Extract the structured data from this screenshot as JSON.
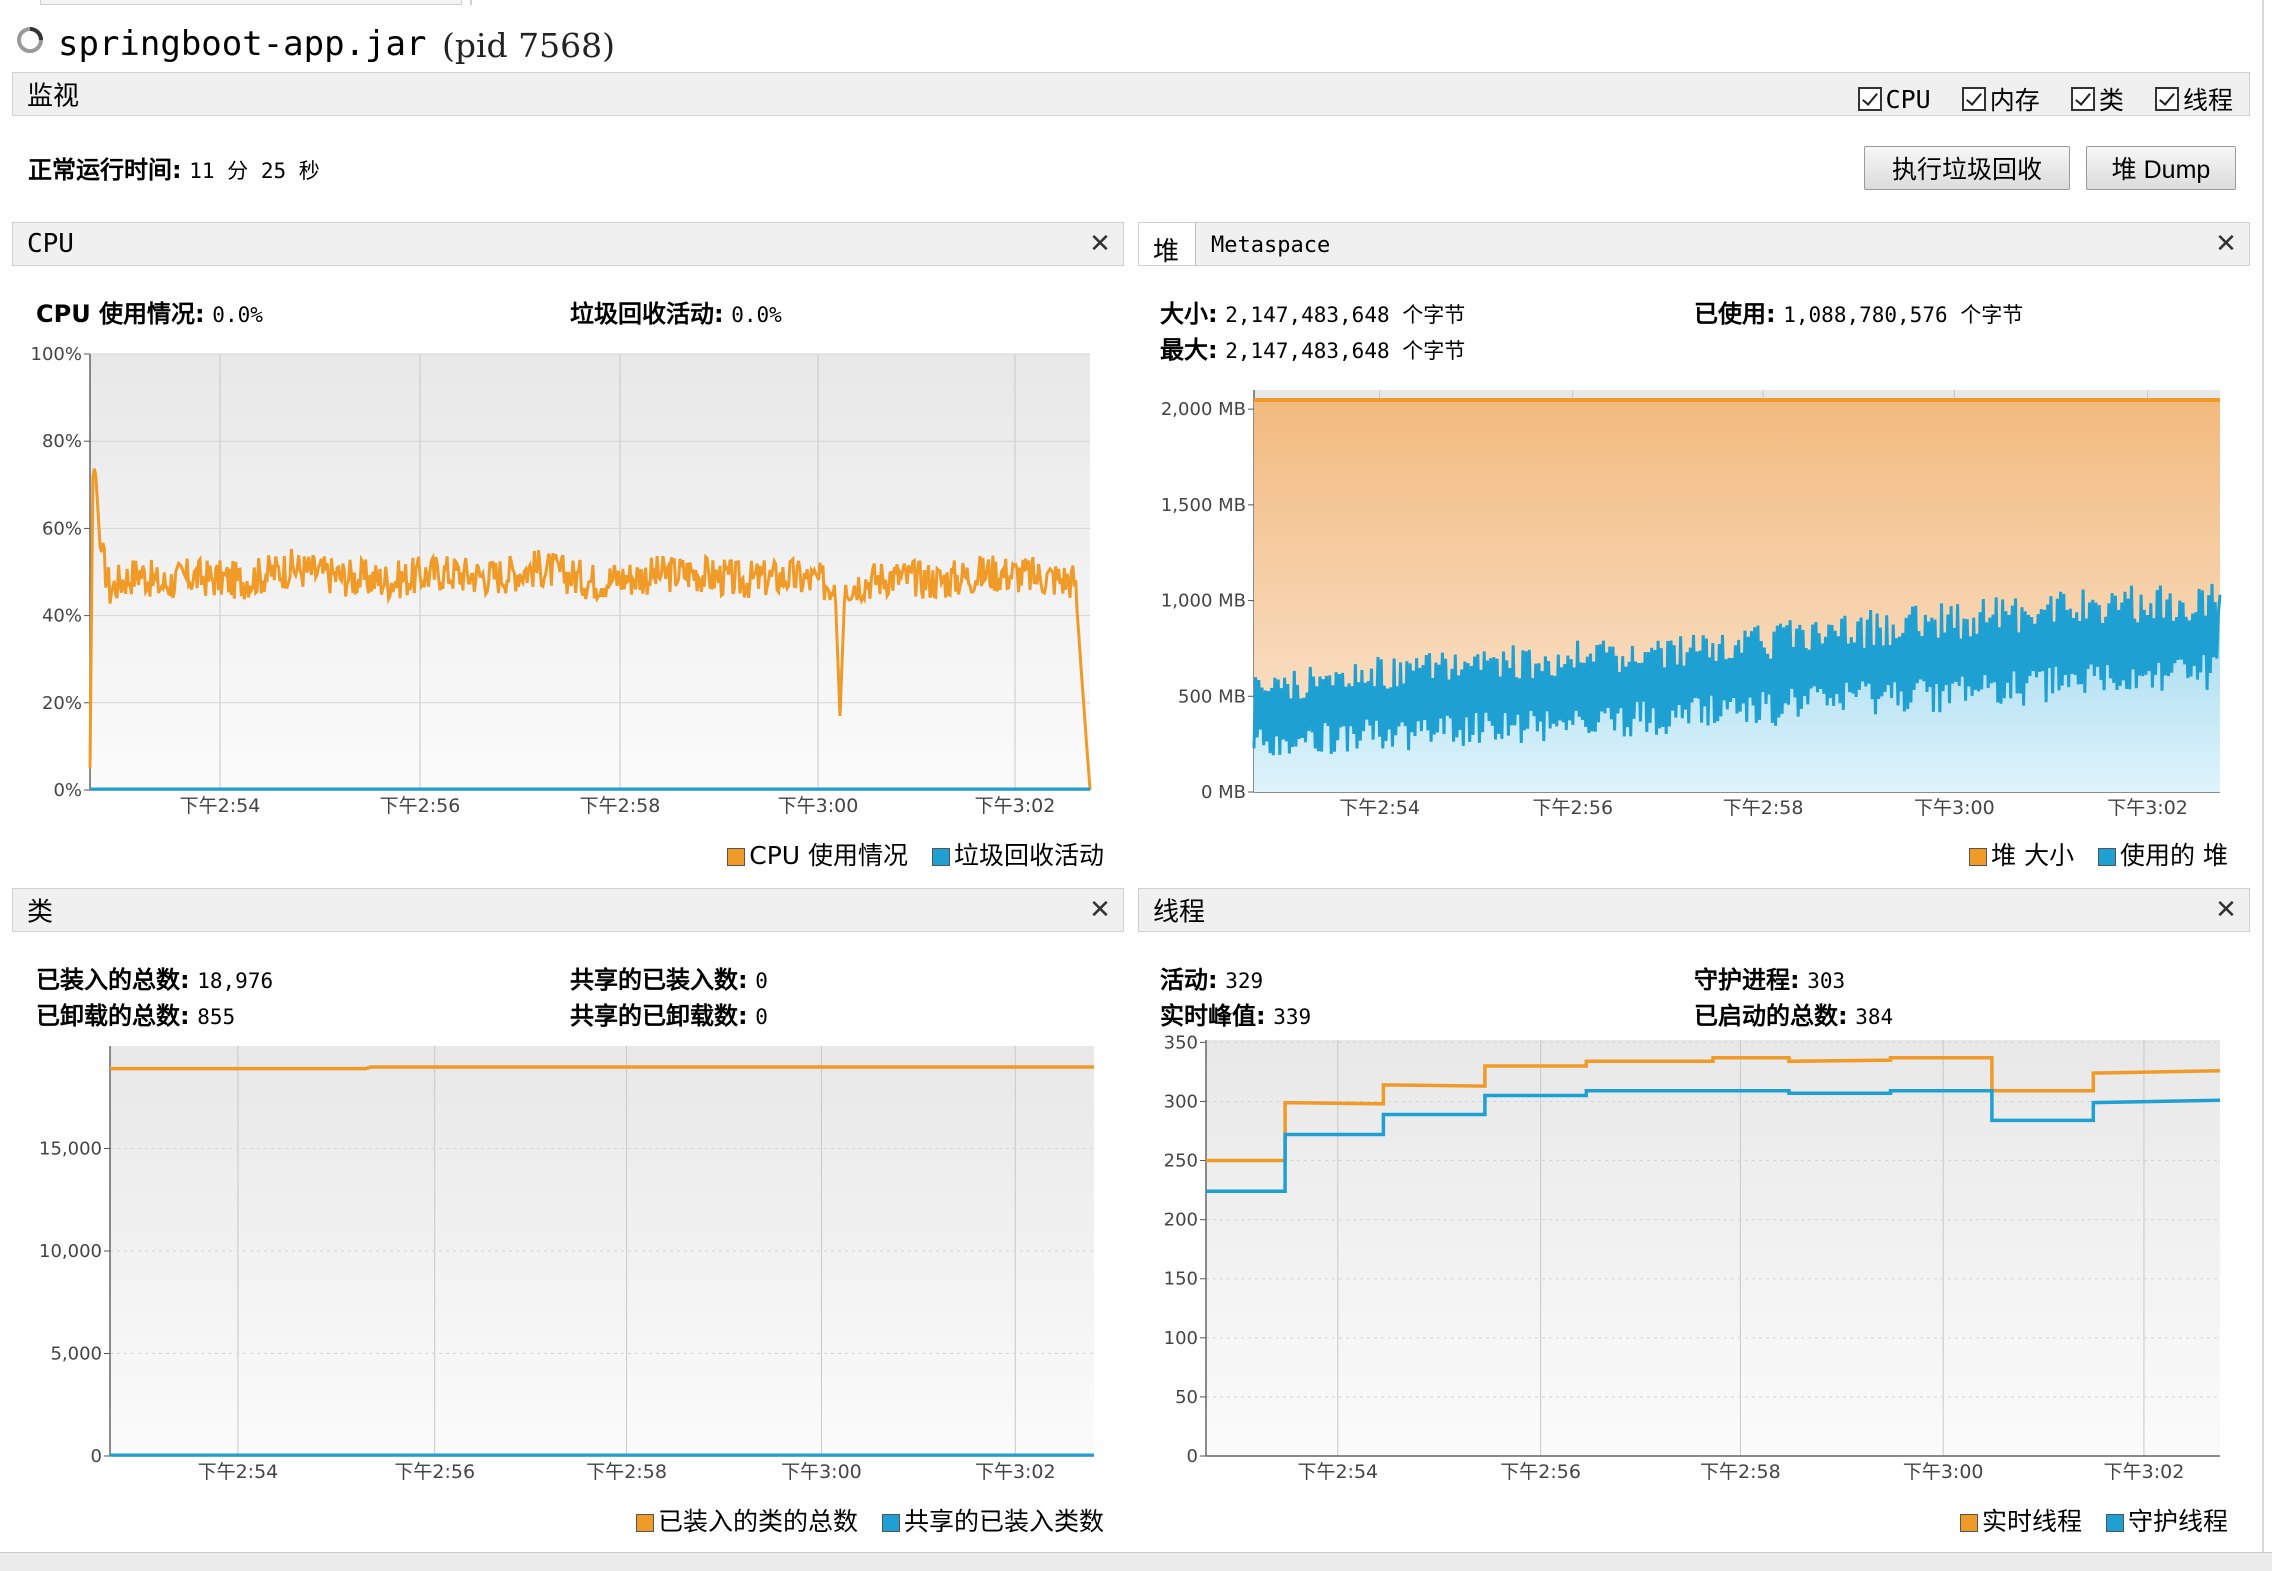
{
  "window": {
    "title": "springboot-app.jar",
    "pid": "(pid 7568)"
  },
  "monitor": {
    "label": "监视",
    "checkboxes": [
      {
        "label": "CPU",
        "checked": true
      },
      {
        "label": "内存",
        "checked": true
      },
      {
        "label": "类",
        "checked": true
      },
      {
        "label": "线程",
        "checked": true
      }
    ],
    "uptime_label": "正常运行时间:",
    "uptime_value": "11 分 25 秒",
    "gc_button": "执行垃圾回收",
    "heap_dump_button": "堆 Dump"
  },
  "cpu_panel": {
    "title": "CPU",
    "usage_label": "CPU 使用情况:",
    "usage_value": "0.0%",
    "gc_label": "垃圾回收活动:",
    "gc_value": "0.0%",
    "legend": [
      {
        "label": "CPU 使用情况",
        "color": "#f09a28"
      },
      {
        "label": "垃圾回收活动",
        "color": "#1ea0d2"
      }
    ]
  },
  "heap_panel": {
    "tabs": [
      "堆",
      "Metaspace"
    ],
    "size_label": "大小:",
    "size_value": "2,147,483,648 个字节",
    "used_label": "已使用:",
    "used_value": "1,088,780,576 个字节",
    "max_label": "最大:",
    "max_value": "2,147,483,648 个字节",
    "legend": [
      {
        "label": "堆 大小",
        "color": "#f09a28"
      },
      {
        "label": "使用的 堆",
        "color": "#1ea0d2"
      }
    ]
  },
  "classes_panel": {
    "title": "类",
    "loaded_label": "已装入的总数:",
    "loaded_value": "18,976",
    "unloaded_label": "已卸载的总数:",
    "unloaded_value": "855",
    "shared_loaded_label": "共享的已装入数:",
    "shared_loaded_value": "0",
    "shared_unloaded_label": "共享的已卸载数:",
    "shared_unloaded_value": "0",
    "legend": [
      {
        "label": "已装入的类的总数",
        "color": "#f09a28"
      },
      {
        "label": "共享的已装入类数",
        "color": "#1ea0d2"
      }
    ]
  },
  "threads_panel": {
    "title": "线程",
    "live_label": "活动:",
    "live_value": "329",
    "daemon_label": "守护进程:",
    "daemon_value": "303",
    "peak_label": "实时峰值:",
    "peak_value": "339",
    "started_label": "已启动的总数:",
    "started_value": "384",
    "legend": [
      {
        "label": "实时线程",
        "color": "#f09a28"
      },
      {
        "label": "守护线程",
        "color": "#1ea0d2"
      }
    ]
  },
  "chart_data": [
    {
      "id": "cpu",
      "type": "line",
      "x_ticks": [
        "下午2:54",
        "下午2:56",
        "下午2:58",
        "下午3:00",
        "下午3:02"
      ],
      "y_ticks": [
        "0%",
        "20%",
        "40%",
        "60%",
        "80%",
        "100%"
      ],
      "ylim": [
        0,
        100
      ],
      "series": [
        {
          "name": "CPU 使用情况",
          "color": "#f09a28",
          "x": [
            0,
            0.3,
            0.6,
            1,
            2,
            3,
            5,
            7,
            10,
            15,
            20,
            25,
            30,
            35,
            40,
            45,
            50,
            55,
            60,
            65,
            70,
            74.5,
            75,
            75.5,
            80,
            85,
            90,
            95,
            98.5,
            99.2,
            100
          ],
          "y": [
            5,
            75,
            72,
            56,
            46,
            48,
            50,
            47,
            49,
            48,
            51,
            49,
            48,
            50,
            49,
            51,
            48,
            49,
            50,
            48,
            49,
            47,
            17,
            47,
            49,
            48,
            50,
            49,
            48,
            25,
            0
          ]
        },
        {
          "name": "垃圾回收活动",
          "color": "#1ea0d2",
          "x": [
            0,
            100
          ],
          "y": [
            0,
            0
          ]
        }
      ]
    },
    {
      "id": "heap",
      "type": "area",
      "x_ticks": [
        "下午2:54",
        "下午2:56",
        "下午2:58",
        "下午3:00",
        "下午3:02"
      ],
      "y_ticks": [
        "0 MB",
        "500 MB",
        "1,000 MB",
        "1,500 MB",
        "2,000 MB"
      ],
      "ylim": [
        0,
        2100
      ],
      "series": [
        {
          "name": "堆 大小",
          "color": "#f09a28",
          "x": [
            0,
            100
          ],
          "y": [
            2048,
            2048
          ]
        },
        {
          "name": "使用的 堆",
          "color": "#1ea0d2",
          "x": [
            0,
            10,
            20,
            30,
            40,
            50,
            60,
            70,
            80,
            90,
            100
          ],
          "low": [
            180,
            200,
            230,
            260,
            290,
            330,
            370,
            410,
            450,
            490,
            540
          ],
          "high": [
            600,
            700,
            740,
            780,
            820,
            860,
            930,
            990,
            1030,
            1080,
            1100
          ],
          "last": 1030
        }
      ]
    },
    {
      "id": "classes",
      "type": "line",
      "x_ticks": [
        "下午2:54",
        "下午2:56",
        "下午2:58",
        "下午3:00",
        "下午3:02"
      ],
      "y_ticks": [
        "0",
        "5,000",
        "10,000",
        "15,000"
      ],
      "ylim": [
        0,
        20000
      ],
      "series": [
        {
          "name": "已装入的类的总数",
          "color": "#f09a28",
          "x": [
            0,
            26,
            26.5,
            100
          ],
          "y": [
            18900,
            18900,
            18976,
            18976
          ]
        },
        {
          "name": "共享的已装入类数",
          "color": "#1ea0d2",
          "x": [
            0,
            100
          ],
          "y": [
            0,
            0
          ]
        }
      ]
    },
    {
      "id": "threads",
      "type": "line",
      "x_ticks": [
        "下午2:54",
        "下午2:56",
        "下午2:58",
        "下午3:00",
        "下午3:02"
      ],
      "y_ticks": [
        "0",
        "50",
        "100",
        "150",
        "200",
        "250",
        "300",
        "350"
      ],
      "ylim": [
        0,
        352
      ],
      "series": [
        {
          "name": "实时线程",
          "color": "#f09a28",
          "x": [
            0,
            7.8,
            7.8,
            17.5,
            17.5,
            27.5,
            27.5,
            37.5,
            37.5,
            50,
            50,
            57.5,
            57.5,
            67.5,
            67.5,
            77.5,
            77.5,
            87.5,
            87.5,
            100
          ],
          "y": [
            250,
            250,
            299,
            298,
            314,
            313,
            330,
            330,
            334,
            334,
            337,
            337,
            334,
            335,
            337,
            337,
            309,
            309,
            324,
            326
          ]
        },
        {
          "name": "守护线程",
          "color": "#1ea0d2",
          "x": [
            0,
            7.8,
            7.8,
            17.5,
            17.5,
            27.5,
            27.5,
            37.5,
            37.5,
            57.5,
            57.5,
            67.5,
            67.5,
            77.5,
            77.5,
            87.5,
            87.5,
            100
          ],
          "y": [
            224,
            224,
            272,
            272,
            289,
            289,
            305,
            305,
            309,
            309,
            307,
            307,
            309,
            309,
            284,
            284,
            299,
            301
          ]
        }
      ]
    }
  ]
}
